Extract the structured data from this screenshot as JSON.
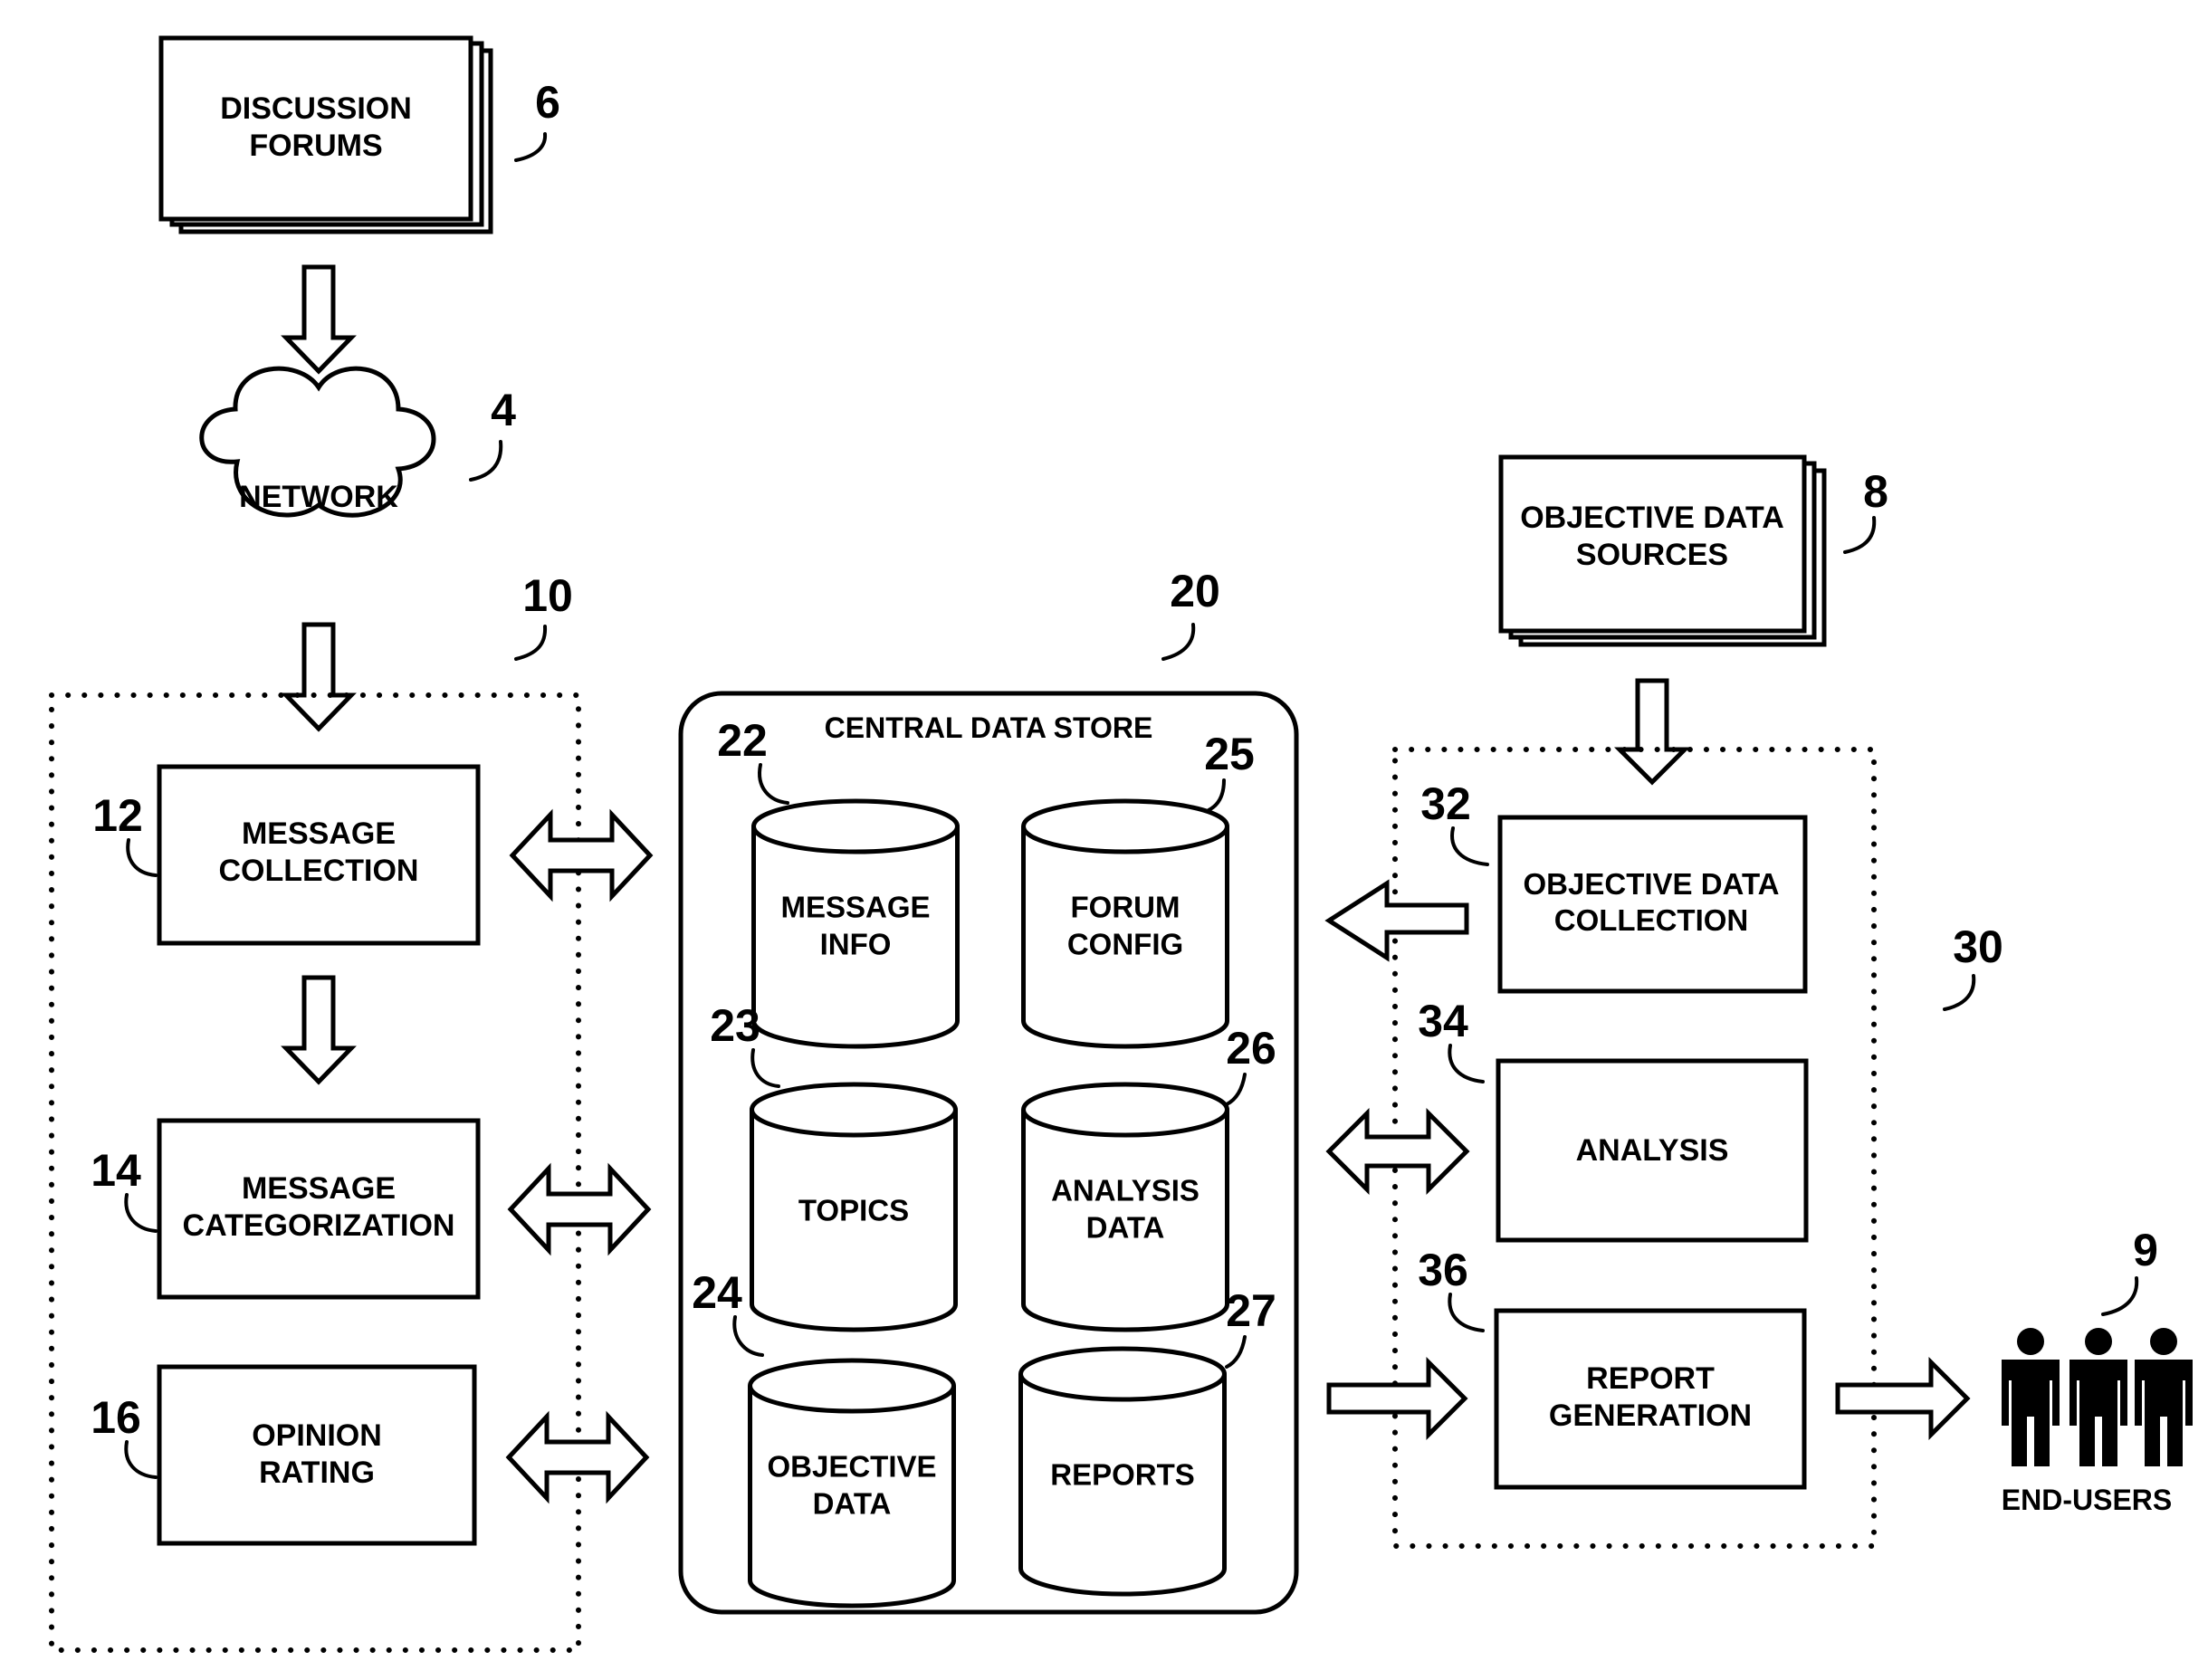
{
  "diagram": {
    "discussion_forums": {
      "label_line1": "DISCUSSION",
      "label_line2": "FORUMS",
      "ref": "6"
    },
    "network": {
      "label": "NETWORK",
      "ref": "4"
    },
    "group_10": {
      "ref": "10",
      "message_collection": {
        "label_line1": "MESSAGE",
        "label_line2": "COLLECTION",
        "ref": "12"
      },
      "message_categorization": {
        "label_line1": "MESSAGE",
        "label_line2": "CATEGORIZATION",
        "ref": "14"
      },
      "opinion_rating": {
        "label_line1": "OPINION",
        "label_line2": "RATING",
        "ref": "16"
      }
    },
    "central_data_store": {
      "title": "CENTRAL DATA STORE",
      "ref": "20",
      "stores": [
        {
          "label_line1": "MESSAGE",
          "label_line2": "INFO",
          "ref": "22"
        },
        {
          "label_line1": "TOPICS",
          "label_line2": "",
          "ref": "23"
        },
        {
          "label_line1": "OBJECTIVE",
          "label_line2": "DATA",
          "ref": "24"
        },
        {
          "label_line1": "FORUM",
          "label_line2": "CONFIG",
          "ref": "25"
        },
        {
          "label_line1": "ANALYSIS",
          "label_line2": "DATA",
          "ref": "26"
        },
        {
          "label_line1": "REPORTS",
          "label_line2": "",
          "ref": "27"
        }
      ]
    },
    "objective_data_sources": {
      "label_line1": "OBJECTIVE DATA",
      "label_line2": "SOURCES",
      "ref": "8"
    },
    "group_30": {
      "ref": "30",
      "objective_data_collection": {
        "label_line1": "OBJECTIVE DATA",
        "label_line2": "COLLECTION",
        "ref": "32"
      },
      "analysis": {
        "label": "ANALYSIS",
        "ref": "34"
      },
      "report_generation": {
        "label_line1": "REPORT",
        "label_line2": "GENERATION",
        "ref": "36"
      }
    },
    "end_users": {
      "label": "END-USERS",
      "ref": "9"
    }
  }
}
